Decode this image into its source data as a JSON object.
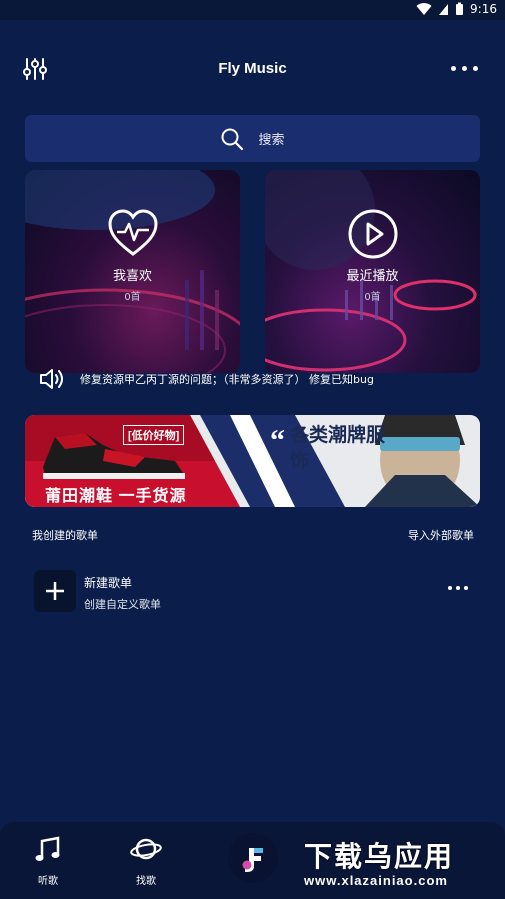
{
  "status_bar": {
    "time": "9:16"
  },
  "header": {
    "title": "Fly Music"
  },
  "search": {
    "placeholder": "搜索"
  },
  "cards": [
    {
      "label": "我喜欢",
      "count": "0首",
      "icon": "heart-pulse-icon"
    },
    {
      "label": "最近播放",
      "count": "0首",
      "icon": "play-circle-icon"
    }
  ],
  "notice": {
    "text": "修复资源甲乙丙丁源的问题；（非常多资源了） 修复已知bug"
  },
  "banner": {
    "tag": "[低价好物]",
    "slogan": "莆田潮鞋 一手货源",
    "title": "各类潮牌服饰"
  },
  "playlists_section": {
    "title": "我创建的歌单",
    "import_label": "导入外部歌单"
  },
  "new_playlist": {
    "name": "新建歌单",
    "desc": "创建自定义歌单"
  },
  "tabbar": {
    "items": [
      {
        "label": "听歌",
        "icon": "music-note-icon"
      },
      {
        "label": "找歌",
        "icon": "planet-icon"
      },
      {
        "label": "",
        "icon": "app-logo-icon"
      },
      {
        "label": "",
        "icon": ""
      },
      {
        "label": "",
        "icon": ""
      }
    ]
  },
  "watermark": {
    "big": "下载乌应用",
    "small": "www.xlazainiao.com"
  },
  "colors": {
    "background": "#0b1d4a",
    "search_bg": "#1a2d6e",
    "banner_red": "#c8102e",
    "tabbar_bg": "#0a1638"
  }
}
